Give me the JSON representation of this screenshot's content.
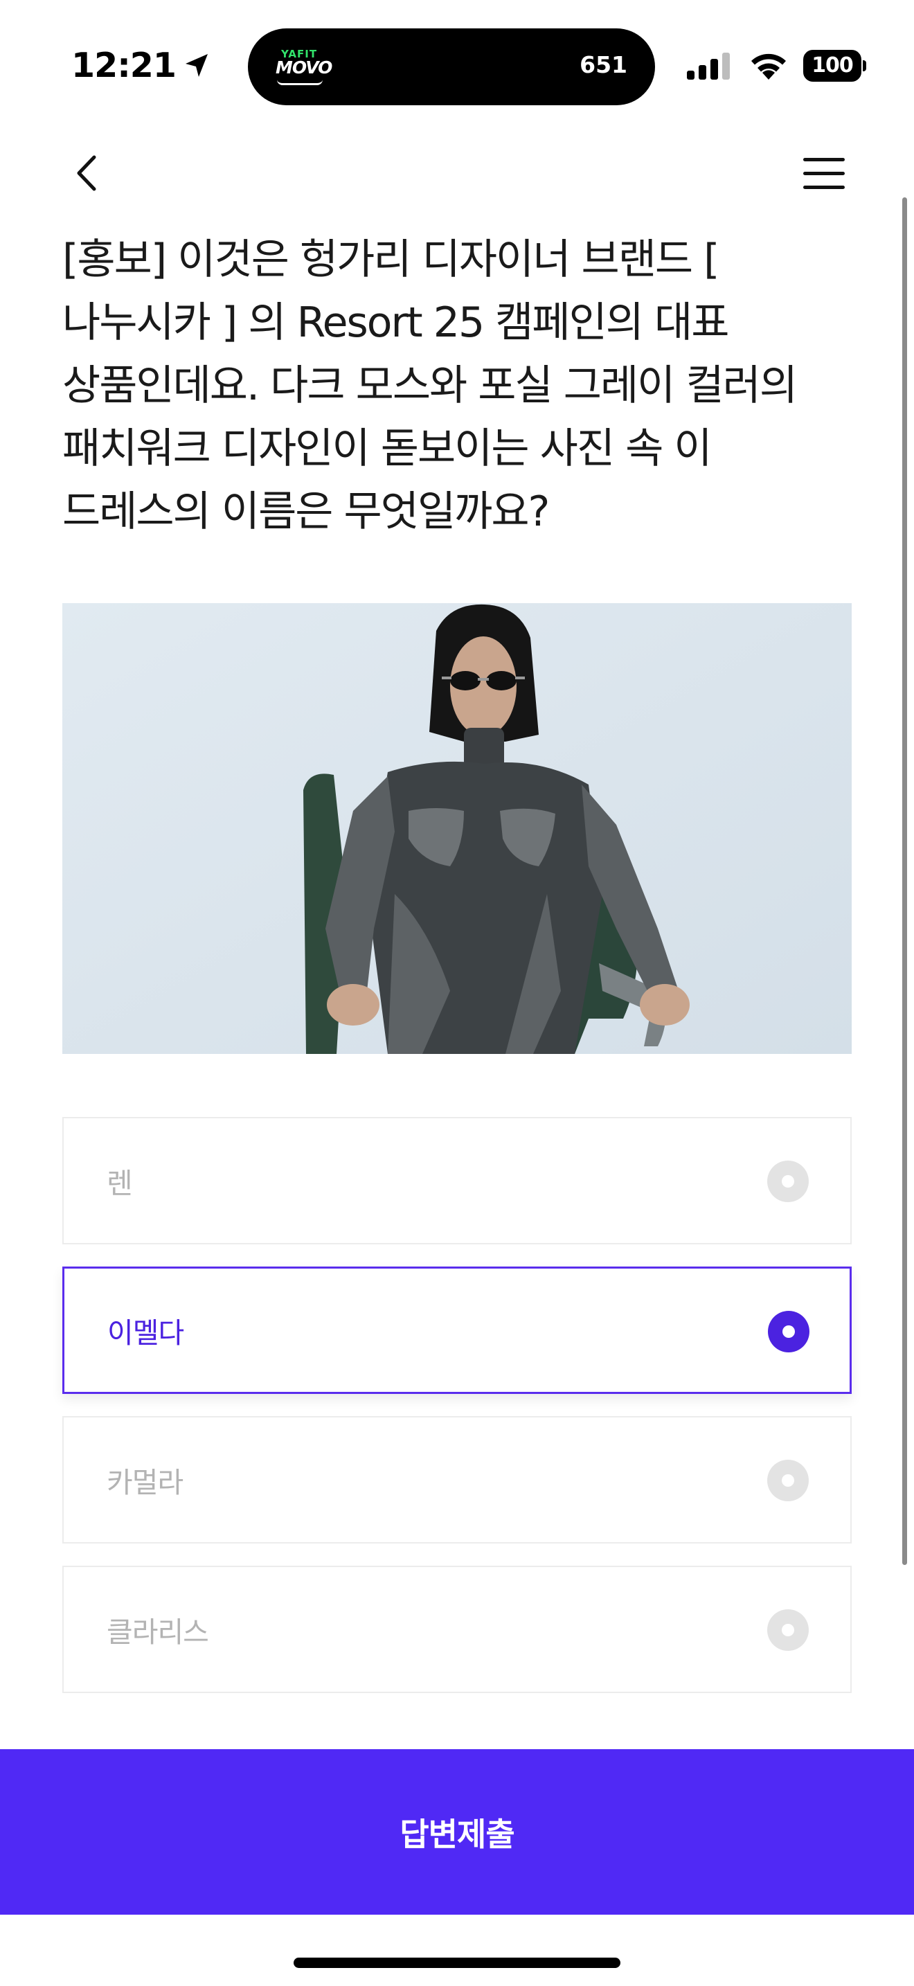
{
  "status_bar": {
    "time": "12:21",
    "island_brand_small": "YAFIT",
    "island_brand_main": "MOVO",
    "island_count": "651",
    "battery": "100",
    "icons": [
      "location-arrow-icon",
      "cellular-signal-icon",
      "wifi-icon",
      "battery-icon"
    ]
  },
  "nav": {
    "back_icon": "chevron-left-icon",
    "menu_icon": "hamburger-menu-icon"
  },
  "question": {
    "text": "[홍보] 이것은 헝가리 디자이너 브랜드 [ 나누시카 ] 의 Resort 25 캠페인의 대표 상품인데요. 다크 모스와 포실 그레이 컬러의 패치워크 디자인이 돋보이는 사진 속 이 드레스의 이름은 무엇일까요?"
  },
  "options": [
    {
      "label": "렌",
      "selected": false
    },
    {
      "label": "이멜다",
      "selected": true
    },
    {
      "label": "카멀라",
      "selected": false
    },
    {
      "label": "클라리스",
      "selected": false
    }
  ],
  "submit": {
    "label": "답변제출"
  },
  "colors": {
    "accent": "#4b22e0",
    "submit_bg": "#5029f5",
    "option_border": "#ececec",
    "unselected_text": "#b3b3b3"
  }
}
